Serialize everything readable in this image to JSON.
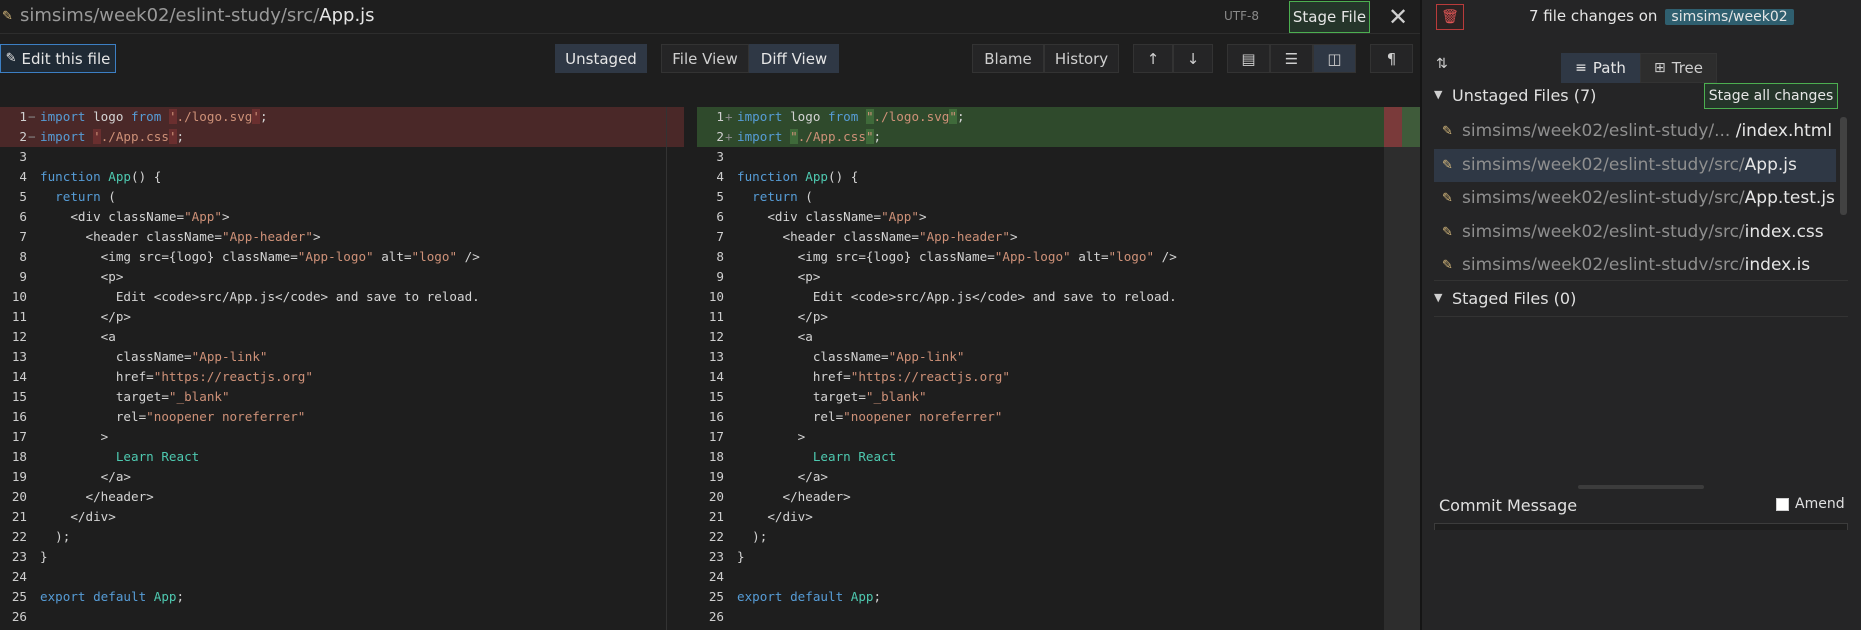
{
  "editor": {
    "file_path_prefix": "simsims/week02/eslint-study/src/",
    "file_name": "App.js",
    "encoding": "UTF-8",
    "stage_file_label": "Stage File",
    "close_symbol": "✕"
  },
  "toolbar": {
    "edit_file_label": "Edit this file",
    "unstaged_label": "Unstaged",
    "file_view_label": "File View",
    "diff_view_label": "Diff View",
    "blame_label": "Blame",
    "history_label": "History",
    "up_symbol": "🡑",
    "down_symbol": "🡓",
    "para_symbol": "¶"
  },
  "sidebar": {
    "changes_summary": "7 file changes on",
    "branch": "simsims/week02",
    "path_label": "Path",
    "tree_label": "Tree",
    "unstaged_header": "Unstaged Files (7)",
    "stage_all_label": "Stage all changes",
    "staged_header": "Staged Files (0)",
    "unstaged_files": [
      {
        "prefix": "simsims/week02/eslint-study/... ",
        "name": "/index.html",
        "selected": false
      },
      {
        "prefix": "simsims/week02/eslint-study/src/",
        "name": "App.js",
        "selected": true
      },
      {
        "prefix": "simsims/week02/eslint-study/src/",
        "name": "App.test.js",
        "selected": false
      },
      {
        "prefix": "simsims/week02/eslint-study/src/",
        "name": "index.css",
        "selected": false
      },
      {
        "prefix": "simsims/week02/eslint-study/src/",
        "name": "index.js",
        "selected": false
      }
    ],
    "commit_message_label": "Commit Message",
    "amend_label": "Amend"
  },
  "diff": {
    "line_numbers": [
      1,
      2,
      3,
      4,
      5,
      6,
      7,
      8,
      9,
      10,
      11,
      12,
      13,
      14,
      15,
      16,
      17,
      18,
      19,
      20,
      21,
      22,
      23,
      24,
      25,
      26
    ],
    "left_lines": [
      "import logo from './logo.svg';",
      "import './App.css';",
      "",
      "function App() {",
      "  return (",
      "    <div className=\"App\">",
      "      <header className=\"App-header\">",
      "        <img src={logo} className=\"App-logo\" alt=\"logo\" />",
      "        <p>",
      "          Edit <code>src/App.js</code> and save to reload.",
      "        </p>",
      "        <a",
      "          className=\"App-link\"",
      "          href=\"https://reactjs.org\"",
      "          target=\"_blank\"",
      "          rel=\"noopener noreferrer\"",
      "        >",
      "          Learn React",
      "        </a>",
      "      </header>",
      "    </div>",
      "  );",
      "}",
      "",
      "export default App;",
      ""
    ],
    "right_lines": [
      "import logo from \"./logo.svg\";",
      "import \"./App.css\";",
      "",
      "function App() {",
      "  return (",
      "    <div className=\"App\">",
      "      <header className=\"App-header\">",
      "        <img src={logo} className=\"App-logo\" alt=\"logo\" />",
      "        <p>",
      "          Edit <code>src/App.js</code> and save to reload.",
      "        </p>",
      "        <a",
      "          className=\"App-link\"",
      "          href=\"https://reactjs.org\"",
      "          target=\"_blank\"",
      "          rel=\"noopener noreferrer\"",
      "        >",
      "          Learn React",
      "        </a>",
      "      </header>",
      "    </div>",
      "  );",
      "}",
      "",
      "export default App;",
      ""
    ],
    "changed_lines": [
      1,
      2
    ],
    "left_marker": "−",
    "right_marker": "+"
  }
}
